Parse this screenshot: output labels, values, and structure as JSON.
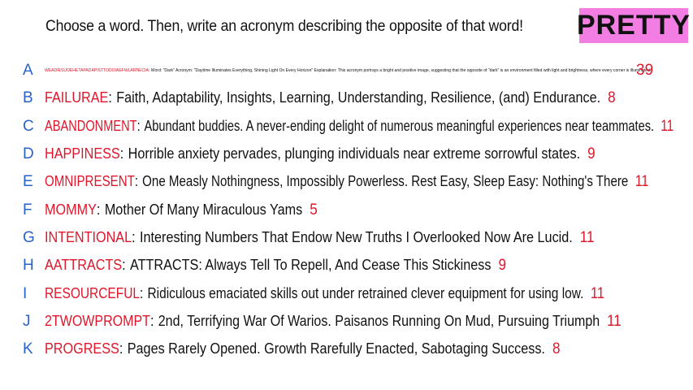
{
  "prompt": "Choose a word. Then, write an acronym describing the opposite of that word!",
  "tag": "PRETTY",
  "rows": [
    {
      "letter": "A",
      "word": "WEADIESUOEHETAPADAPISTTODOIAEFWLARNECIA",
      "acronym": "Word: \"Dark\" Acronym: \"Daytime Illuminates Everything, Shining Light On Every Horizon\"  Explanation: This acronym portrays a bright and positive image, suggesting that the opposite of \"dark\" is an environment filled with light and brightness, where every corner is illuminated.",
      "score": "39"
    },
    {
      "letter": "B",
      "word": "FAILURAE",
      "acronym": "Faith, Adaptability, Insights, Learning, Understanding, Resilience, (and) Endurance.",
      "score": "8"
    },
    {
      "letter": "C",
      "word": "ABANDONMENT",
      "acronym": "Abundant buddies. A never-ending delight of numerous meaningful experiences near teammates.",
      "score": "11"
    },
    {
      "letter": "D",
      "word": "HAPPINESS",
      "acronym": "Horrible anxiety pervades, plunging individuals near extreme sorrowful states.",
      "score": "9"
    },
    {
      "letter": "E",
      "word": "OMNIPRESENT",
      "acronym": "One Measly Nothingness, Impossibly Powerless. Rest Easy, Sleep Easy: Nothing's There",
      "score": "11"
    },
    {
      "letter": "F",
      "word": "MOMMY",
      "acronym": "Mother Of Many Miraculous Yams",
      "score": "5"
    },
    {
      "letter": "G",
      "word": "INTENTIONAL",
      "acronym": "Interesting Numbers That Endow New Truths I Overlooked Now Are Lucid.",
      "score": "11"
    },
    {
      "letter": "H",
      "word": "AATTRACTS",
      "acronym": "ATTRACTS: Always Tell To Repell, And Cease This Stickiness",
      "score": "9"
    },
    {
      "letter": "I",
      "word": "RESOURCEFUL",
      "acronym": "Ridiculous emaciated skills out under retrained clever equipment for using low.",
      "score": "11"
    },
    {
      "letter": "J",
      "word": "2TWOWPROMPT",
      "acronym": "2nd, Terrifying War Of Warios. Paisanos Running On Mud, Pursuing Triumph",
      "score": "11"
    },
    {
      "letter": "K",
      "word": "PROGRESS",
      "acronym": "Pages Rarely Opened. Growth Rarefully Enacted, Sabotaging Success.",
      "score": "8"
    }
  ],
  "colors": {
    "word": "#e0162b",
    "letter": "#2a63c8",
    "tag_bg": "#f37ee3",
    "text": "#111111"
  }
}
